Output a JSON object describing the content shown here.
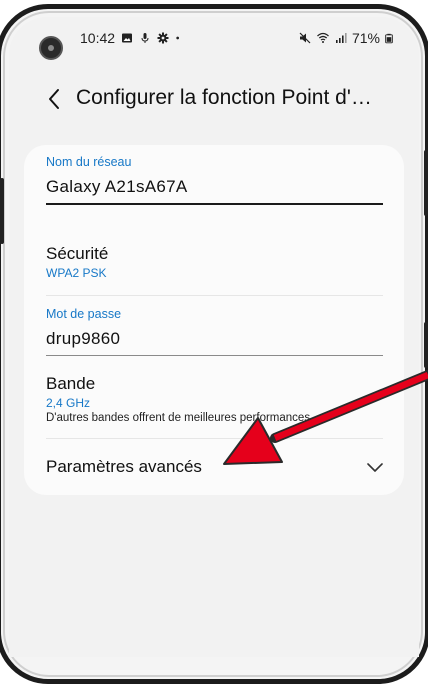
{
  "status": {
    "time": "10:42",
    "battery": "71%"
  },
  "header": {
    "title": "Configurer la fonction Point d'…"
  },
  "fields": {
    "network_name": {
      "label": "Nom du réseau",
      "value": "Galaxy A21sA67A"
    },
    "security": {
      "title": "Sécurité",
      "value": "WPA2 PSK"
    },
    "password": {
      "label": "Mot de passe",
      "value": "drup9860"
    },
    "band": {
      "title": "Bande",
      "value": "2,4 GHz",
      "note": "D'autres bandes offrent de meilleures performances."
    },
    "advanced": {
      "title": "Paramètres avancés"
    }
  },
  "colors": {
    "accent": "#1778c7",
    "annotation_arrow": "#e5001b"
  },
  "icons": [
    "camera-icon",
    "gallery-icon",
    "mic-icon",
    "settings-icon",
    "dot-icon",
    "mute-icon",
    "wifi-icon",
    "signal-icon",
    "battery-icon",
    "back-icon",
    "chevron-down-icon"
  ]
}
